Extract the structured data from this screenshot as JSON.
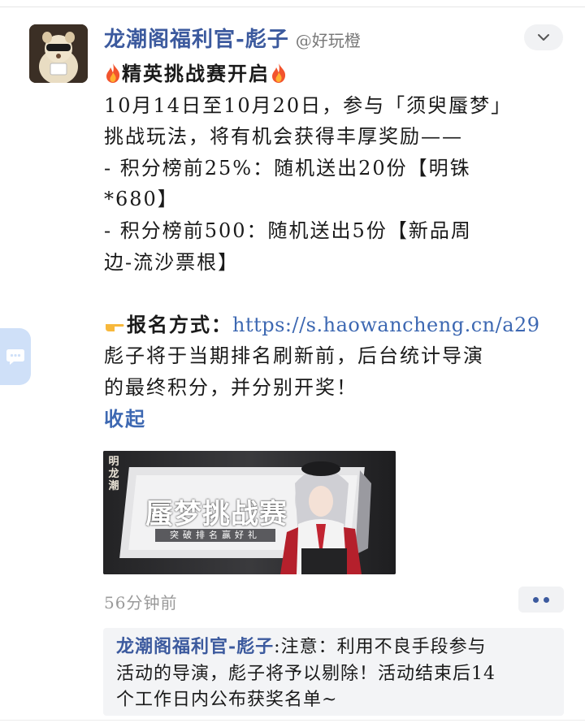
{
  "post": {
    "author_name": "龙潮阁福利官-彪子",
    "author_handle": "@好玩橙",
    "title": "精英挑战赛开启",
    "body_lines": [
      "10月14日至10月20日，参与「须臾蜃梦」",
      "挑战玩法，将有机会获得丰厚奖励——",
      "- 积分榜前25%：随机送出20份【明铢",
      "*680】",
      "- 积分榜前500：随机送出5份【新品周",
      "边-流沙票根】"
    ],
    "signup_label": "报名方式：",
    "signup_link": "https://s.haowancheng.cn/a29",
    "closing_lines": [
      "彪子将于当期排名刷新前，后台统计导演",
      "的最终积分，并分别开奖！"
    ],
    "collapse_label": "收起",
    "timestamp": "56分钟前"
  },
  "banner": {
    "brand": "明龙潮",
    "title": "蜃梦挑战赛",
    "subtitle": "突破排名赢好礼"
  },
  "comment": {
    "author": "龙潮阁福利官-彪子",
    "separator": ":",
    "text_line1": "注意：利用不良手段参与",
    "text_line2": "活动的导演，彪子将予以剔除！活动结束后14",
    "text_line3": "个工作日内公布获奖名单~"
  },
  "icons": {
    "more": "chevron-down-icon",
    "actions": "more-dots-icon",
    "side": "chat-bubble-icon",
    "fire": "fire-emoji",
    "hand": "pointing-hand-emoji"
  },
  "colors": {
    "accent": "#3c5a9e",
    "link": "#3d68b2",
    "muted": "#9a9a9a",
    "comment_bg": "#f3f4f6"
  }
}
